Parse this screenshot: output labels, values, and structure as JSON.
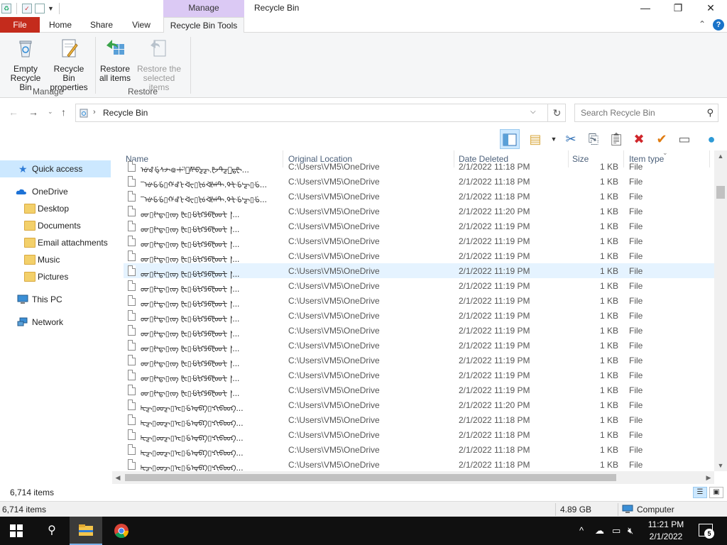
{
  "window": {
    "title": "Recycle Bin",
    "context_tab_group": "Manage",
    "minimize": "—",
    "maximize": "❐",
    "close": "✕"
  },
  "ribbon_tabs": {
    "file": "File",
    "home": "Home",
    "share": "Share",
    "view": "View",
    "recycle_bin_tools": "Recycle Bin Tools",
    "expand": "⌃",
    "help": "?"
  },
  "ribbon": {
    "manage_group": {
      "label": "Manage",
      "empty_recycle_bin": "Empty\nRecycle Bin",
      "empty_line1": "Empty",
      "empty_line2": "Recycle Bin",
      "properties_line1": "Recycle Bin",
      "properties_line2": "properties"
    },
    "restore_group": {
      "label": "Restore",
      "restore_all_line1": "Restore",
      "restore_all_line2": "all items",
      "restore_selected_line1": "Restore the",
      "restore_selected_line2": "selected items"
    }
  },
  "address": {
    "location": "Recycle Bin",
    "search_placeholder": "Search Recycle Bin"
  },
  "nav_pane": {
    "items": [
      {
        "label": "Quick access",
        "icon": "star-icon"
      },
      {
        "label": "OneDrive",
        "icon": "cloud-icon"
      },
      {
        "label": "Desktop",
        "icon": "folder-icon"
      },
      {
        "label": "Documents",
        "icon": "folder-icon"
      },
      {
        "label": "Email attachments",
        "icon": "folder-icon"
      },
      {
        "label": "Music",
        "icon": "folder-icon"
      },
      {
        "label": "Pictures",
        "icon": "folder-icon"
      },
      {
        "label": "This PC",
        "icon": "computer-icon"
      },
      {
        "label": "Network",
        "icon": "network-icon"
      }
    ]
  },
  "columns": {
    "name": "Name",
    "original_location": "Original Location",
    "date_deleted": "Date Deleted",
    "size": "Size",
    "item_type": "Item type"
  },
  "rows": [
    {
      "name": "̃ᡠᡃ꘩ᢹ̣ᠰᢣ᪤ꗻᵎ̈ᡍ̣ᢝᡦᡓᡓ.ᡛᡔᠲᡓᡚ̣ᡖᡛ...",
      "loc": "C:\\Users\\VM5\\OneDrive",
      "date": "2/1/2022 11:18 PM",
      "size": "1 KB",
      "type": "File"
    },
    {
      "name": "‾ᡠᡃᢹᢹ▯ᡤ꘩ᡶᢱᠸ▯ᡫᡠᢱᡃᡲᡤᠲ.ᡐᡶᢹᡃᡓ▯ᢹ...",
      "loc": "C:\\Users\\VM5\\OneDrive",
      "date": "2/1/2022 11:18 PM",
      "size": "1 KB",
      "type": "File"
    },
    {
      "name": "‾ᡠᡃᢹᢹ▯ᡤ꘩ᡶᢱᠸ▯ᡫᡠᢱᡃᡲᡤᠲ.ᡐᡶᢹᡃᡓ▯ᢹ...",
      "loc": "C:\\Users\\VM5\\OneDrive",
      "date": "2/1/2022 11:18 PM",
      "size": "1 KB",
      "type": "File"
    },
    {
      "name": "ᡂ▯ᡲᡃᡖ▯ᡕᡋ ᡛᡄ▯ᢹᡃᡶᡗᡱᡦᡛᡂᡶ |ᡃ...",
      "loc": "C:\\Users\\VM5\\OneDrive",
      "date": "2/1/2022 11:20 PM",
      "size": "1 KB",
      "type": "File"
    },
    {
      "name": "ᡂ▯ᡲᡃᡖ▯ᡕᡋ ᡛᡄ▯ᢹᡃᡶᡗᡱᡦᡛᡂᡶ |ᡃ...",
      "loc": "C:\\Users\\VM5\\OneDrive",
      "date": "2/1/2022 11:19 PM",
      "size": "1 KB",
      "type": "File"
    },
    {
      "name": "ᡂ▯ᡲᡃᡖ▯ᡕᡋ ᡛᡄ▯ᢹᡃᡶᡗᡱᡦᡛᡂᡶ |ᡃ...",
      "loc": "C:\\Users\\VM5\\OneDrive",
      "date": "2/1/2022 11:19 PM",
      "size": "1 KB",
      "type": "File"
    },
    {
      "name": "ᡂ▯ᡲᡃᡖ▯ᡕᡋ ᡛᡄ▯ᢹᡃᡶᡗᡱᡦᡛᡂᡶ |ᡃ...",
      "loc": "C:\\Users\\VM5\\OneDrive",
      "date": "2/1/2022 11:19 PM",
      "size": "1 KB",
      "type": "File"
    },
    {
      "name": "ᡂ▯ᡲᡃᡖ▯ᡕᡋ ᡛᡄ▯ᢹᡃᡶᡗᡱᡦᡛᡂᡶ |ᡃ...",
      "loc": "C:\\Users\\VM5\\OneDrive",
      "date": "2/1/2022 11:19 PM",
      "size": "1 KB",
      "type": "File"
    },
    {
      "name": "ᡂ▯ᡲᡃᡖ▯ᡕᡋ ᡛᡄ▯ᢹᡃᡶᡗᡱᡦᡛᡂᡶ |ᡃ...",
      "loc": "C:\\Users\\VM5\\OneDrive",
      "date": "2/1/2022 11:19 PM",
      "size": "1 KB",
      "type": "File"
    },
    {
      "name": "ᡂ▯ᡲᡃᡖ▯ᡕᡋ ᡛᡄ▯ᢹᡃᡶᡗᡱᡦᡛᡂᡶ |ᡃ...",
      "loc": "C:\\Users\\VM5\\OneDrive",
      "date": "2/1/2022 11:19 PM",
      "size": "1 KB",
      "type": "File"
    },
    {
      "name": "ᡂ▯ᡲᡃᡖ▯ᡕᡋ ᡛᡄ▯ᢹᡃᡶᡗᡱᡦᡛᡂᡶ |ᡃ...",
      "loc": "C:\\Users\\VM5\\OneDrive",
      "date": "2/1/2022 11:19 PM",
      "size": "1 KB",
      "type": "File"
    },
    {
      "name": "ᡂ▯ᡲᡃᡖ▯ᡕᡋ ᡛᡄ▯ᢹᡃᡶᡗᡱᡦᡛᡂᡶ |ᡃ...",
      "loc": "C:\\Users\\VM5\\OneDrive",
      "date": "2/1/2022 11:19 PM",
      "size": "1 KB",
      "type": "File"
    },
    {
      "name": "ᡂ▯ᡲᡃᡖ▯ᡕᡋ ᡛᡄ▯ᢹᡃᡶᡗᡱᡦᡛᡂᡶ |ᡃ...",
      "loc": "C:\\Users\\VM5\\OneDrive",
      "date": "2/1/2022 11:19 PM",
      "size": "1 KB",
      "type": "File"
    },
    {
      "name": "ᡂ▯ᡲᡃᡖ▯ᡕᡋ ᡛᡄ▯ᢹᡃᡶᡗᡱᡦᡛᡂᡶ |ᡃ...",
      "loc": "C:\\Users\\VM5\\OneDrive",
      "date": "2/1/2022 11:19 PM",
      "size": "1 KB",
      "type": "File"
    },
    {
      "name": "ᡂ▯ᡲᡃᡖ▯ᡕᡋ ᡛᡄ▯ᢹᡃᡶᡗᡱᡦᡛᡂᡶ |ᡃ...",
      "loc": "C:\\Users\\VM5\\OneDrive",
      "date": "2/1/2022 11:19 PM",
      "size": "1 KB",
      "type": "File"
    },
    {
      "name": "ᡂ▯ᡲᡃᡖ▯ᡕᡋ ᡛᡄ▯ᢹᡃᡶᡗᡱᡦᡛᡂᡶ |ᡃ...",
      "loc": "C:\\Users\\VM5\\OneDrive",
      "date": "2/1/2022 11:19 PM",
      "size": "1 KB",
      "type": "File"
    },
    {
      "name": "ᡰᡄᡓ▯ᡂᡓ▯ᡄ▯ᢹᡇᡦᡗ▯ᡃᡗᡕᡦᡂᡗ...",
      "loc": "C:\\Users\\VM5\\OneDrive",
      "date": "2/1/2022 11:20 PM",
      "size": "1 KB",
      "type": "File"
    },
    {
      "name": "ᡰᡄᡓ▯ᡂᡓ▯ᡄ▯ᢹᡇᡦᡗ▯ᡃᡗᡕᡦᡂᡗ...",
      "loc": "C:\\Users\\VM5\\OneDrive",
      "date": "2/1/2022 11:18 PM",
      "size": "1 KB",
      "type": "File"
    },
    {
      "name": "ᡰᡄᡓ▯ᡂᡓ▯ᡄ▯ᢹᡇᡦᡗ▯ᡃᡗᡕᡦᡂᡗ...",
      "loc": "C:\\Users\\VM5\\OneDrive",
      "date": "2/1/2022 11:18 PM",
      "size": "1 KB",
      "type": "File"
    },
    {
      "name": "ᡰᡄᡓ▯ᡂᡓ▯ᡄ▯ᢹᡇᡦᡗ▯ᡃᡗᡕᡦᡂᡗ...",
      "loc": "C:\\Users\\VM5\\OneDrive",
      "date": "2/1/2022 11:18 PM",
      "size": "1 KB",
      "type": "File"
    },
    {
      "name": "ᡰᡄᡓ▯ᡂᡓ▯ᡄ▯ᢹᡇᡦᡗ▯ᡃᡗᡕᡦᡂᡗ...",
      "loc": "C:\\Users\\VM5\\OneDrive",
      "date": "2/1/2022 11:18 PM",
      "size": "1 KB",
      "type": "File"
    }
  ],
  "hovered_row_index": 7,
  "status": {
    "item_count": "6,714 items",
    "bottom_item_count": "6,714 items",
    "total_size": "4.89 GB",
    "location_label": "Computer"
  },
  "taskbar": {
    "time": "11:21 PM",
    "date": "2/1/2022",
    "notification_count": "5"
  },
  "colors": {
    "file_tab": "#c42b1c",
    "context_tab": "#dbc9f4",
    "selection": "#cce8ff",
    "hover_row": "#e5f3ff",
    "taskbar": "#101010"
  }
}
